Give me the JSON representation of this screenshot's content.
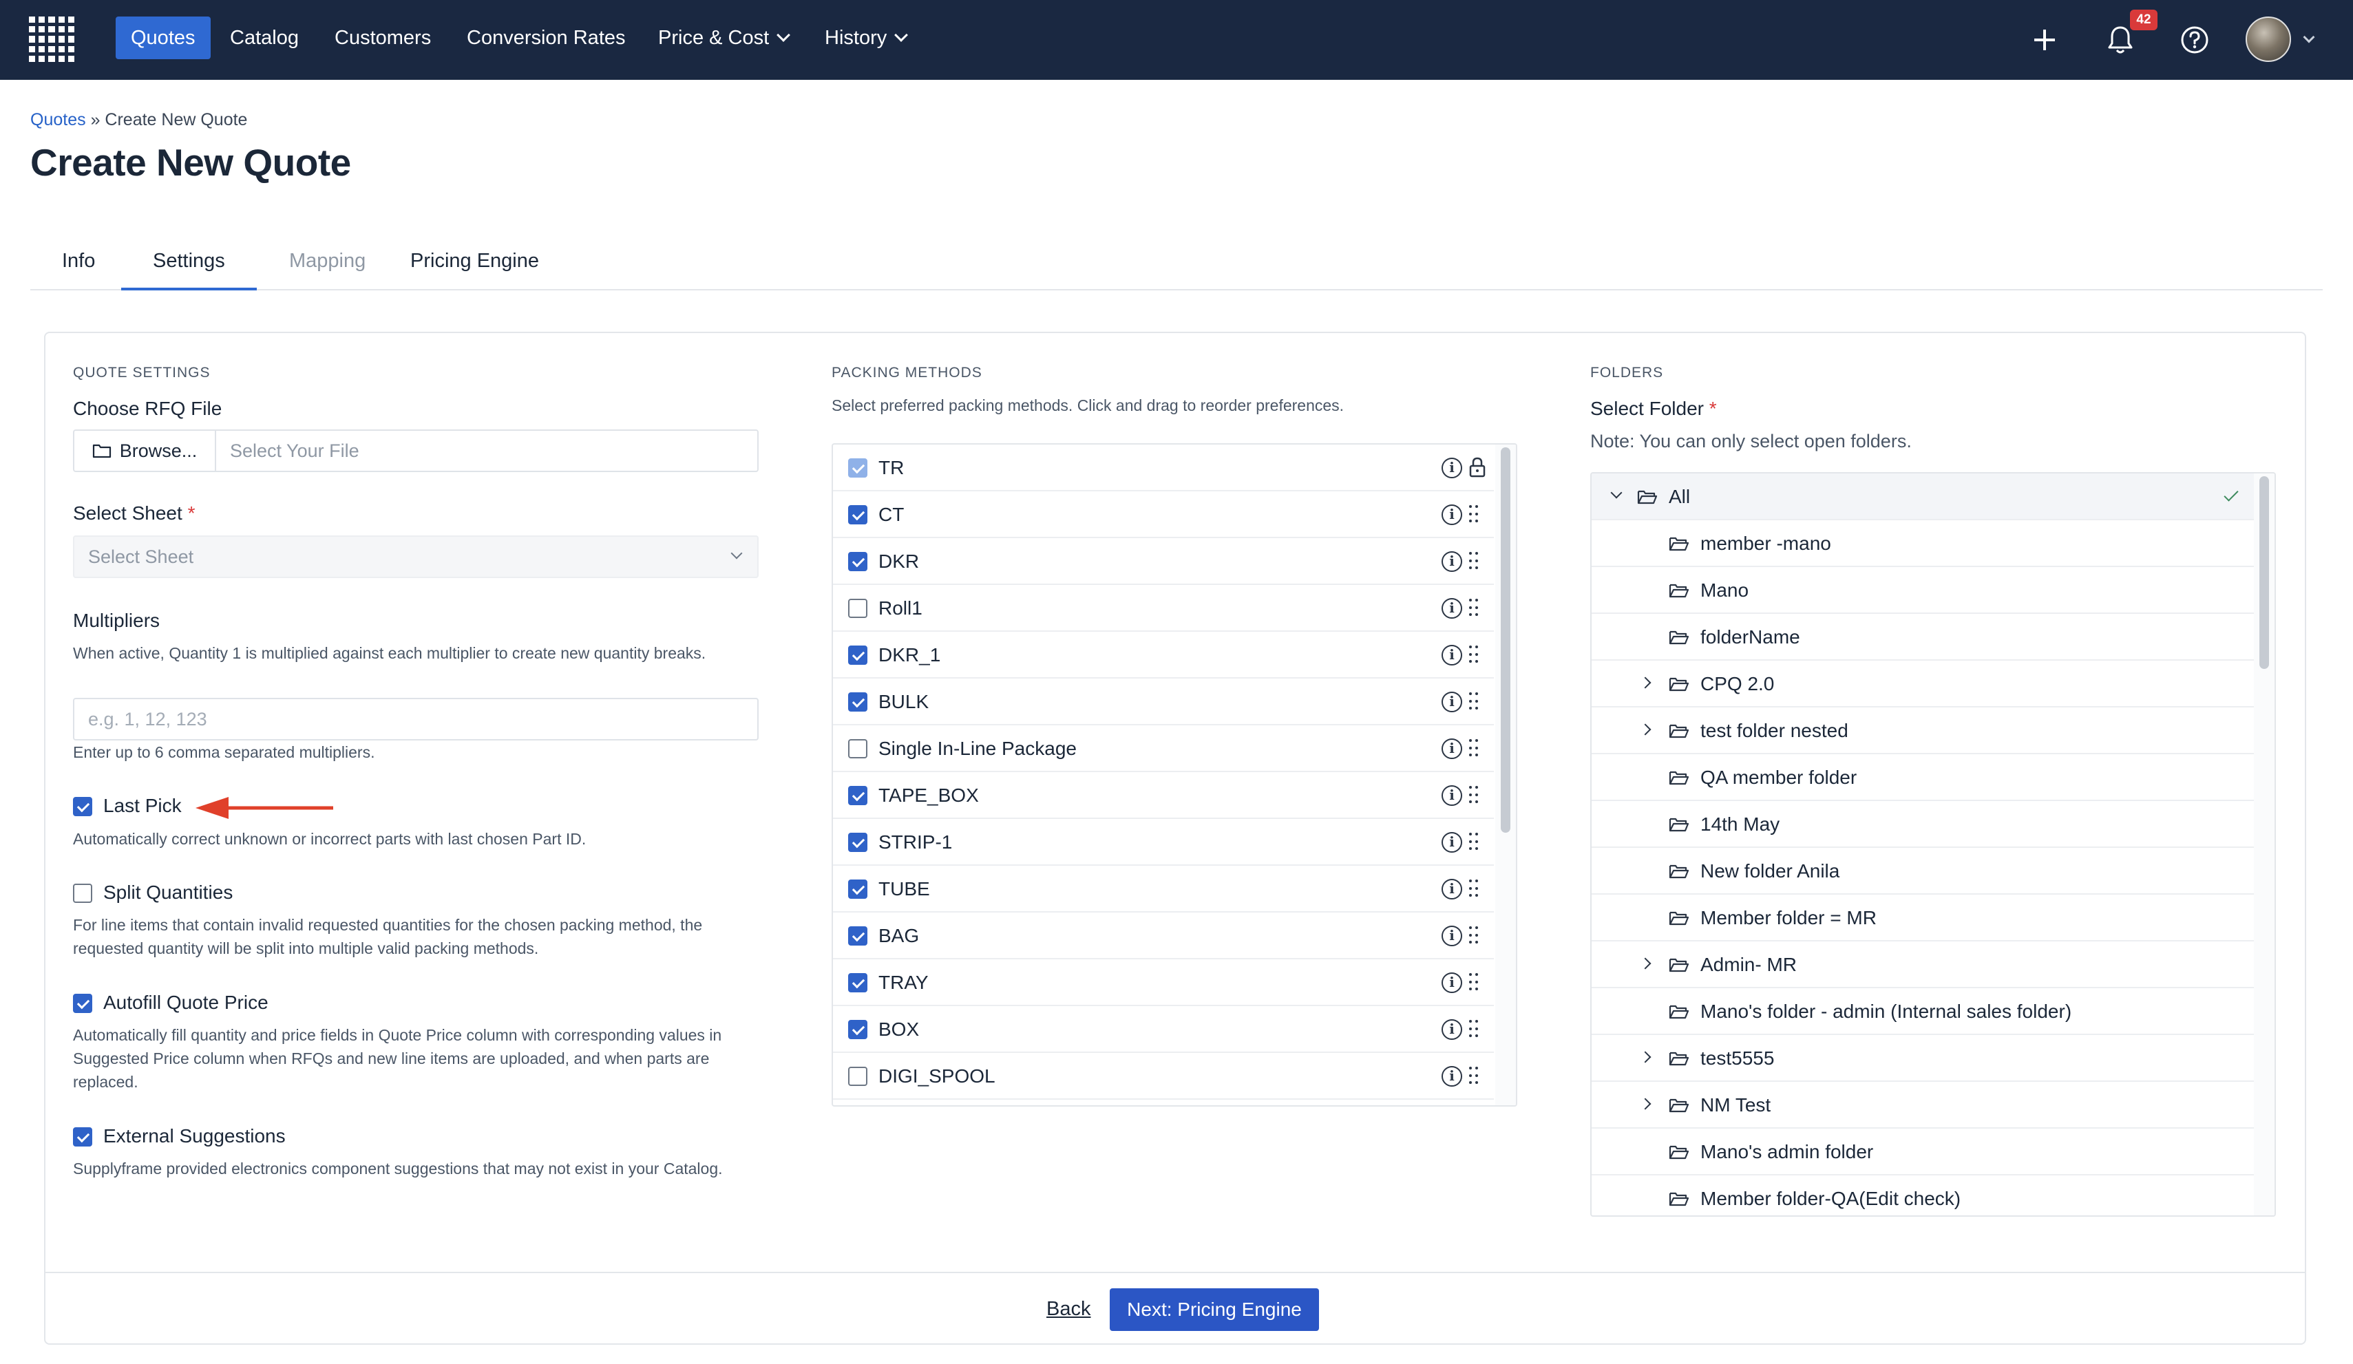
{
  "nav": {
    "items": [
      "Quotes",
      "Catalog",
      "Customers",
      "Conversion Rates",
      "Price & Cost",
      "History"
    ],
    "notification_count": "42",
    "icons": [
      "app-grid-icon",
      "plus-icon",
      "bell-icon",
      "help-icon",
      "chevron-down-icon"
    ],
    "accent_color": "#2f69d2",
    "bar_color": "#1a2841"
  },
  "breadcrumb": {
    "link": "Quotes",
    "separator": "»",
    "current": "Create New Quote"
  },
  "page": {
    "title": "Create New Quote"
  },
  "tabs": [
    {
      "label": "Info",
      "state": "default"
    },
    {
      "label": "Settings",
      "state": "active"
    },
    {
      "label": "Mapping",
      "state": "disabled"
    },
    {
      "label": "Pricing Engine",
      "state": "default"
    }
  ],
  "quote_settings": {
    "section_title": "QUOTE SETTINGS",
    "rfq_label": "Choose RFQ File",
    "browse_label": "Browse...",
    "file_placeholder": "Select Your File",
    "sheet_label": "Select Sheet",
    "sheet_placeholder": "Select Sheet",
    "multipliers_label": "Multipliers",
    "multipliers_help": "When active, Quantity 1 is multiplied against each multiplier to create new quantity breaks.",
    "multipliers_placeholder": "e.g. 1, 12, 123",
    "multipliers_hint": "Enter up to 6 comma separated multipliers.",
    "options": [
      {
        "label": "Last Pick",
        "checked": true,
        "help": "Automatically correct unknown or incorrect parts with last chosen Part ID."
      },
      {
        "label": "Split Quantities",
        "checked": false,
        "help": "For line items that contain invalid requested quantities for the chosen packing method, the requested quantity will be split into multiple valid packing methods."
      },
      {
        "label": "Autofill Quote Price",
        "checked": true,
        "help": "Automatically fill quantity and price fields in Quote Price column with corresponding values in Suggested Price column when RFQs and new line items are uploaded, and when parts are replaced."
      },
      {
        "label": "External Suggestions",
        "checked": true,
        "help": "Supplyframe provided electronics component suggestions that may not exist in your Catalog."
      }
    ]
  },
  "packing_methods": {
    "section_title": "PACKING METHODS",
    "help": "Select preferred packing methods. Click and drag to reorder preferences.",
    "items": [
      {
        "name": "TR",
        "checked": true,
        "locked": true
      },
      {
        "name": "CT",
        "checked": true
      },
      {
        "name": "DKR",
        "checked": true
      },
      {
        "name": "Roll1",
        "checked": false
      },
      {
        "name": "DKR_1",
        "checked": true
      },
      {
        "name": "BULK",
        "checked": true
      },
      {
        "name": "Single In-Line Package",
        "checked": false
      },
      {
        "name": "TAPE_BOX",
        "checked": true
      },
      {
        "name": "STRIP-1",
        "checked": true
      },
      {
        "name": "TUBE",
        "checked": true
      },
      {
        "name": "BAG",
        "checked": true
      },
      {
        "name": "TRAY",
        "checked": true
      },
      {
        "name": "BOX",
        "checked": true
      },
      {
        "name": "DIGI_SPOOL",
        "checked": false
      }
    ]
  },
  "folders": {
    "section_title": "FOLDERS",
    "select_label": "Select Folder",
    "note": "Note: You can only select open folders.",
    "items": [
      {
        "name": "All",
        "level": 0,
        "expander": "expanded",
        "selected": true
      },
      {
        "name": "member -mano",
        "level": 1,
        "expander": "none"
      },
      {
        "name": "Mano",
        "level": 1,
        "expander": "none"
      },
      {
        "name": "folderName",
        "level": 1,
        "expander": "none"
      },
      {
        "name": "CPQ 2.0",
        "level": 1,
        "expander": "collapsed"
      },
      {
        "name": "test folder nested",
        "level": 1,
        "expander": "collapsed"
      },
      {
        "name": "QA member folder",
        "level": 1,
        "expander": "none"
      },
      {
        "name": "14th May",
        "level": 1,
        "expander": "none"
      },
      {
        "name": "New folder Anila",
        "level": 1,
        "expander": "none"
      },
      {
        "name": "Member folder = MR",
        "level": 1,
        "expander": "none"
      },
      {
        "name": "Admin- MR",
        "level": 1,
        "expander": "collapsed"
      },
      {
        "name": "Mano's folder - admin (Internal sales folder)",
        "level": 1,
        "expander": "none"
      },
      {
        "name": "test5555",
        "level": 1,
        "expander": "collapsed"
      },
      {
        "name": "NM Test",
        "level": 1,
        "expander": "collapsed"
      },
      {
        "name": "Mano's admin folder",
        "level": 1,
        "expander": "none"
      },
      {
        "name": "Member folder-QA(Edit check)",
        "level": 1,
        "expander": "none"
      }
    ]
  },
  "footer": {
    "back_label": "Back",
    "next_label": "Next: Pricing Engine",
    "next_color": "#2b56c5"
  },
  "annotation": {
    "arrow_color": "#e0402a"
  }
}
